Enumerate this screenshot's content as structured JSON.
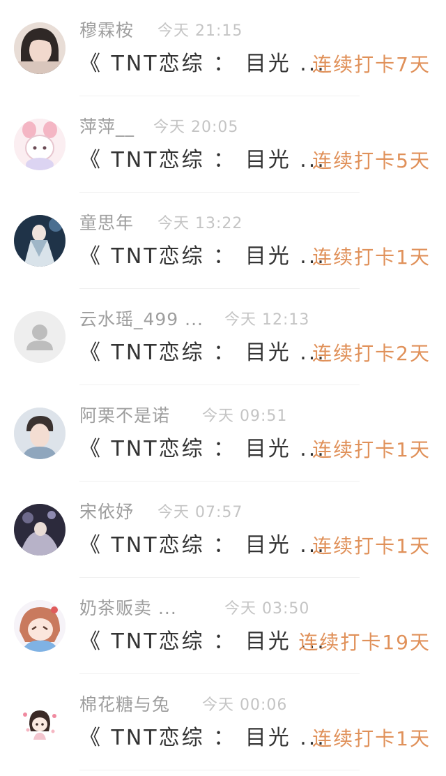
{
  "checkins": [
    {
      "name": "穆霖桉",
      "time": "今天 21:15",
      "title": "《 TNT恋综 ： 目光 ...",
      "streak": "连续打卡7天",
      "avatar": "photo-girl-icon"
    },
    {
      "name": "萍萍__",
      "time": "今天 20:05",
      "title": "《 TNT恋综 ： 目光 ...",
      "streak": "连续打卡5天",
      "avatar": "anime-bunny-icon"
    },
    {
      "name": "童思年",
      "time": "今天 13:22",
      "title": "《 TNT恋综 ： 目光 ...",
      "streak": "连续打卡1天",
      "avatar": "stage-performer-icon"
    },
    {
      "name": "云水瑶_499 ...",
      "time": "今天 12:13",
      "title": "《 TNT恋综 ： 目光 ...",
      "streak": "连续打卡2天",
      "avatar": "default-user-icon"
    },
    {
      "name": "阿栗不是诺",
      "time": "今天 09:51",
      "title": "《 TNT恋综 ： 目光 ...",
      "streak": "连续打卡1天",
      "avatar": "photo-boy-icon"
    },
    {
      "name": "宋依妤",
      "time": "今天 07:57",
      "title": "《 TNT恋综 ： 目光 ...",
      "streak": "连续打卡1天",
      "avatar": "concert-photo-icon"
    },
    {
      "name": "奶茶贩卖 ...",
      "time": "今天 03:50",
      "title": "《 TNT恋综 ： 目光 ...",
      "streak": "连续打卡19天",
      "avatar": "anime-girl-icon"
    },
    {
      "name": "棉花糖与兔",
      "time": "今天 00:06",
      "title": "《 TNT恋综 ： 目光 ...",
      "streak": "连续打卡1天",
      "avatar": "chibi-girl-icon"
    }
  ],
  "colors": {
    "streak": "#e0915a",
    "name": "#9e9e9e",
    "time": "#c4c4c4",
    "title": "#333333"
  }
}
